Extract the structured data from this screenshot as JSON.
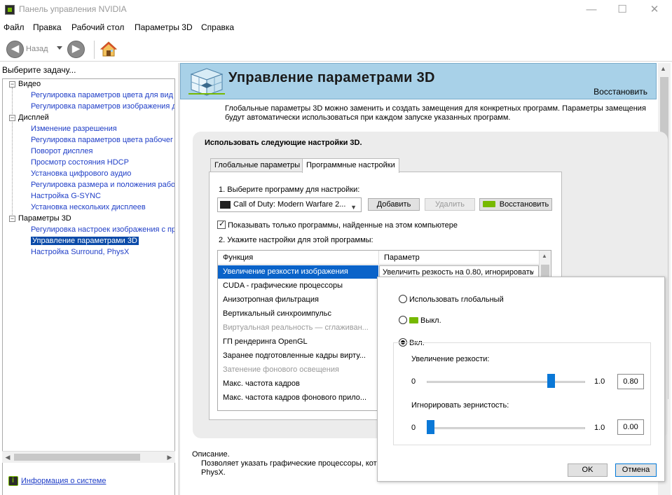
{
  "window": {
    "title": "Панель управления NVIDIA",
    "minimize": "—",
    "maximize": "☐",
    "close": "✕"
  },
  "menu": [
    "Файл",
    "Правка",
    "Рабочий стол",
    "Параметры 3D",
    "Справка"
  ],
  "toolbar": {
    "back_label": "Назад",
    "back_icon": "◀",
    "forward_icon": "▶"
  },
  "left": {
    "task_label": "Выберите задачу...",
    "categories": [
      {
        "label": "Видео",
        "items": [
          "Регулировка параметров цвета для вид",
          "Регулировка параметров изображения д"
        ]
      },
      {
        "label": "Дисплей",
        "items": [
          "Изменение разрешения",
          "Регулировка параметров цвета рабочег",
          "Поворот дисплея",
          "Просмотр состояния HDCP",
          "Установка цифрового аудио",
          "Регулировка размера и положения рабо",
          "Настройка G-SYNC",
          "Установка нескольких дисплеев"
        ]
      },
      {
        "label": "Параметры 3D",
        "items": [
          "Регулировка настроек изображения с пр",
          "Управление параметрами 3D",
          "Настройка Surround, PhysX"
        ]
      }
    ],
    "selected_item": "Управление параметрами 3D",
    "expander_symbol": "−",
    "system_info": "Информация о системе"
  },
  "header": {
    "title": "Управление параметрами 3D",
    "restore": "Восстановить"
  },
  "intro": "Глобальные параметры 3D можно заменить и создать замещения для конкретных программ. Параметры замещения будут автоматически использоваться при каждом запуске указанных программ.",
  "settings": {
    "title": "Использовать следующие настройки 3D.",
    "tabs": [
      "Глобальные параметры",
      "Программные настройки"
    ],
    "active_tab": "Программные настройки",
    "step1": "1. Выберите программу для настройки:",
    "program": "Call of Duty: Modern Warfare 2...",
    "add_button": "Добавить",
    "remove_button": "Удалить",
    "restore_button": "Восстановить",
    "show_only_checkbox": "Показывать только программы, найденные на этом компьютере",
    "show_only_checked": true,
    "step2": "2. Укажите настройки для этой программы:",
    "columns": [
      "Функция",
      "Параметр"
    ],
    "rows": [
      {
        "function": "Увеличение резкости изображения",
        "value": "Увеличить резкость на 0.80, игнорировать",
        "selected": true,
        "dim": false
      },
      {
        "function": "CUDA - графические процессоры",
        "dim": false
      },
      {
        "function": "Анизотропная фильтрация",
        "dim": false
      },
      {
        "function": "Вертикальный синхроимпульс",
        "dim": false
      },
      {
        "function": "Виртуальная реальность — сглаживан...",
        "dim": true
      },
      {
        "function": "ГП рендеринга OpenGL",
        "dim": false
      },
      {
        "function": "Заранее подготовленные кадры вирту...",
        "dim": false
      },
      {
        "function": "Затенение фонового освещения",
        "dim": true
      },
      {
        "function": "Макс. частота кадров",
        "dim": false
      },
      {
        "function": "Макс. частота кадров фонового прило...",
        "dim": false
      }
    ]
  },
  "description": {
    "label": "Описание.",
    "text_line1": "Позволяет указать графические процессоры, кот",
    "text_line2": "PhysX."
  },
  "popup": {
    "option_global": "Использовать глобальный",
    "option_off": "Выкл.",
    "option_on": "Вкл.",
    "selected_option": "Вкл.",
    "sharpen_label": "Увеличение резкости:",
    "sharpen_min": "0",
    "sharpen_max": "1.0",
    "sharpen_value": "0.80",
    "sharpen_level": 0.8,
    "grain_label": "Игнорировать зернистость:",
    "grain_min": "0",
    "grain_max": "1.0",
    "grain_value": "0.00",
    "grain_level": 0.0,
    "ok": "OK",
    "cancel": "Отмена"
  },
  "colors": {
    "nvidia_green": "#76b900",
    "link_blue": "#1f3ec7",
    "header_blue": "#a8d1e8",
    "selection_blue": "#0a63c9"
  }
}
